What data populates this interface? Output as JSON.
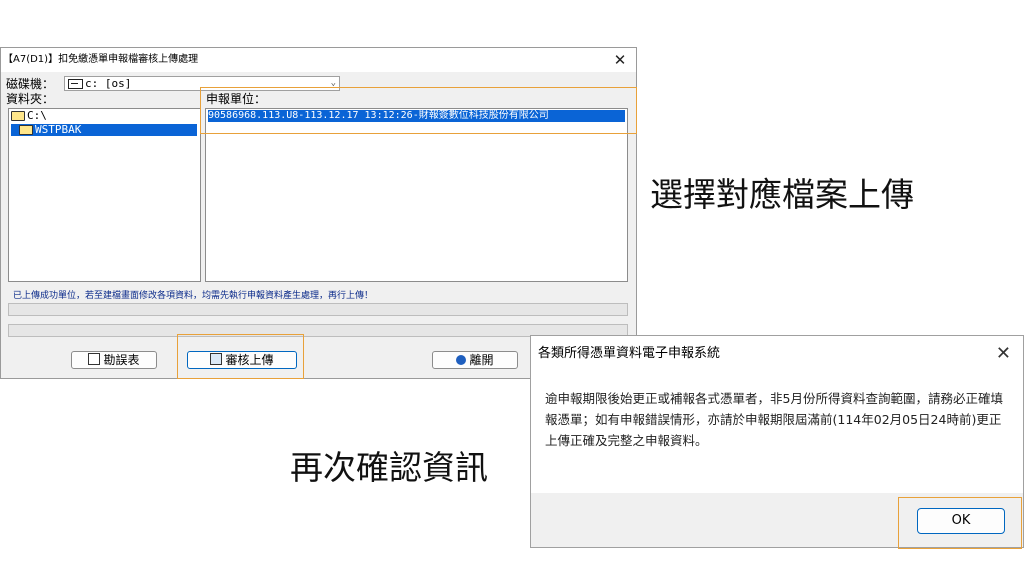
{
  "main_window": {
    "title": "【A7(D1)】扣免繳憑單申報檔審核上傳處理",
    "close_glyph": "✕",
    "drive_label": "磁碟機：",
    "drive_value": "c: [os]",
    "folder_label": "資料夾：",
    "folders": [
      "C:\\",
      "WSTPBAK"
    ],
    "unit_label": "申報單位：",
    "units": [
      "90586968.113.U8-113.12.17 13:12:26-財報簽數位科技股份有限公司"
    ],
    "message": "已上傳成功單位，若至建檔畫面修改各項資料，均需先執行申報資料產生處理，再行上傳！",
    "buttons": {
      "error_report": "勘誤表",
      "review_upload": "審核上傳",
      "exit": "離開"
    }
  },
  "dialog": {
    "title": "各類所得憑單資料電子申報系統",
    "close_glyph": "✕",
    "message": "逾申報期限後始更正或補報各式憑單者，非5月份所得資料查詢範圍，請務必正確填報憑單；如有申報錯誤情形，亦請於申報期限屆滿前(114年02月05日24時前)更正上傳正確及完整之申報資料。",
    "ok_label": "OK"
  },
  "captions": {
    "select_file": "選擇對應檔案上傳",
    "confirm_info": "再次確認資訊"
  },
  "colors": {
    "highlight": "#e8a13a",
    "selection": "#0a64d6"
  }
}
